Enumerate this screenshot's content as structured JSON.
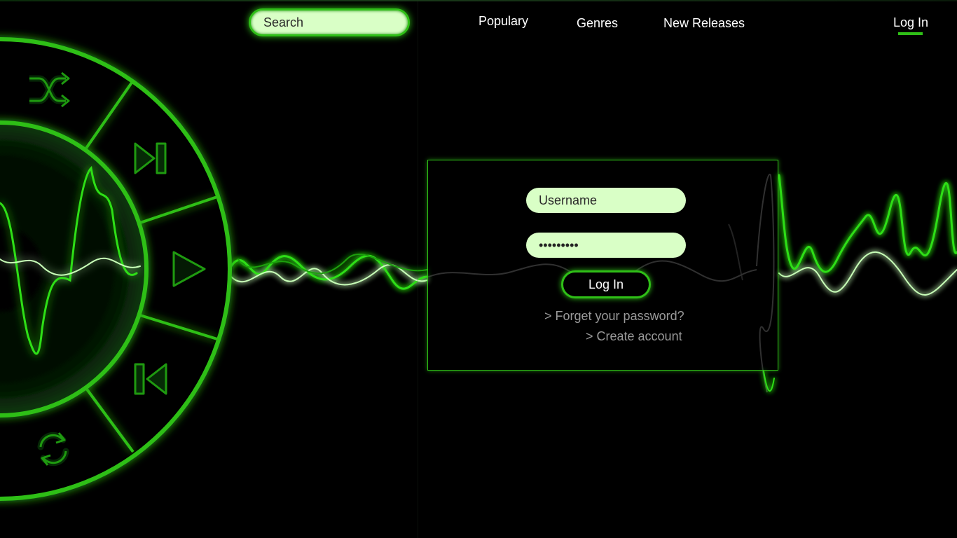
{
  "header": {
    "search": {
      "placeholder": "Search",
      "value": ""
    },
    "nav": [
      {
        "label": "Populary"
      },
      {
        "label": "Genres"
      },
      {
        "label": "New Releases"
      }
    ],
    "login_link": "Log In"
  },
  "login_form": {
    "username": {
      "placeholder": "Username",
      "value": ""
    },
    "password": {
      "placeholder": "",
      "value": "•••••••••"
    },
    "submit_label": "Log In",
    "forgot_link": "> Forget your password?",
    "create_link": "> Create account"
  },
  "player": {
    "controls": [
      "shuffle-icon",
      "next-track-icon",
      "play-icon",
      "previous-track-icon",
      "repeat-icon"
    ]
  },
  "colors": {
    "accent": "#2fbf17",
    "field_bg": "#d9ffc6",
    "background": "#000000",
    "link_text": "#9a9a9a"
  }
}
